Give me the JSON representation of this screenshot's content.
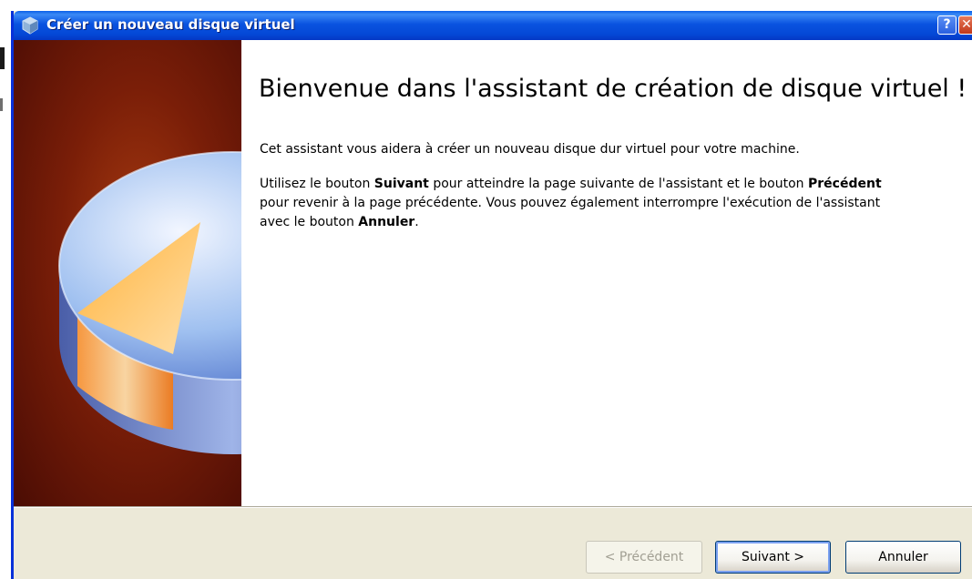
{
  "window": {
    "title": "Créer un nouveau disque virtuel",
    "help_button": "?",
    "close_button": "✕"
  },
  "wizard": {
    "heading": "Bienvenue dans l'assistant de création de disque virtuel !",
    "intro": "Cet assistant vous aidera à créer un nouveau disque dur virtuel pour votre machine.",
    "instructions": {
      "t1": "Utilisez le bouton ",
      "b1": "Suivant",
      "t2": " pour atteindre la page suivante de l'assistant et le bouton ",
      "b2": "Précédent",
      "t3": " pour revenir à la page précédente. Vous pouvez également interrompre l'exécution de l'assistant avec le bouton ",
      "b3": "Annuler",
      "t4": "."
    }
  },
  "buttons": {
    "previous": "< Précédent",
    "next": "Suivant >",
    "cancel": "Annuler"
  },
  "icons": {
    "title_icon": "virtualbox-cube-icon",
    "side_image": "disk-pie-icon"
  },
  "colors": {
    "titlebar": "#0a53e0",
    "side_panel": "#7a1e08",
    "dialog_bg": "#ece9d8"
  }
}
